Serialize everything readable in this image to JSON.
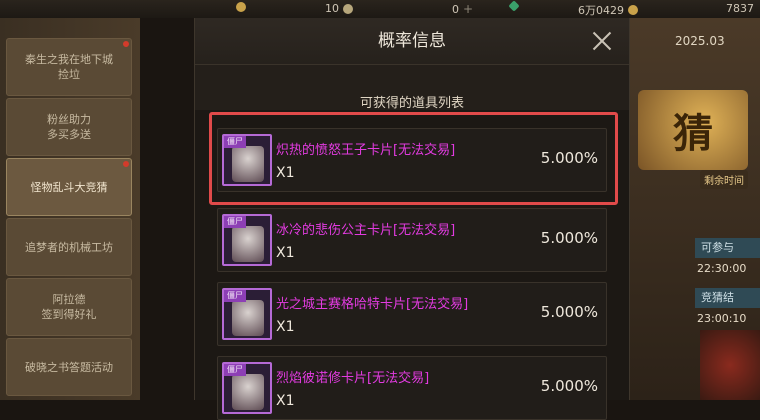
{
  "topbar": {
    "res1_value": "10",
    "res2_value": "0",
    "res3_value": "6万0429",
    "res4_value": "7837"
  },
  "sidebar": {
    "items": [
      {
        "label": "秦生之我在地下城",
        "label2": "捡垃"
      },
      {
        "label": "粉丝助力",
        "label2": "多买多送"
      },
      {
        "label": "怪物乱斗大竞猜",
        "label2": ""
      },
      {
        "label": "追梦者的机械工坊",
        "label2": ""
      },
      {
        "label": "阿拉德",
        "label2": "签到得好礼"
      },
      {
        "label": "破晓之书答题活动",
        "label2": ""
      }
    ]
  },
  "right": {
    "date": "2025.03",
    "banner": "猜",
    "tag": "剩余时间",
    "box1": "可参与",
    "time1": "22:30:00",
    "box2": "竞猜结",
    "time2": "23:00:10"
  },
  "dialog": {
    "title": "概率信息",
    "subtitle": "可获得的道具列表",
    "badge": "僵尸",
    "items": [
      {
        "name": "炽热的愤怒王子卡片[无法交易]",
        "qty": "X1",
        "rate": "5.000%"
      },
      {
        "name": "冰冷的悲伤公主卡片[无法交易]",
        "qty": "X1",
        "rate": "5.000%"
      },
      {
        "name": "光之城主赛格哈特卡片[无法交易]",
        "qty": "X1",
        "rate": "5.000%"
      },
      {
        "name": "烈焰彼诺修卡片[无法交易]",
        "qty": "X1",
        "rate": "5.000%"
      }
    ]
  },
  "colors": {
    "item_name": "#e23be0",
    "highlight": "#e04a4a",
    "icon_border": "#b56ad6"
  }
}
